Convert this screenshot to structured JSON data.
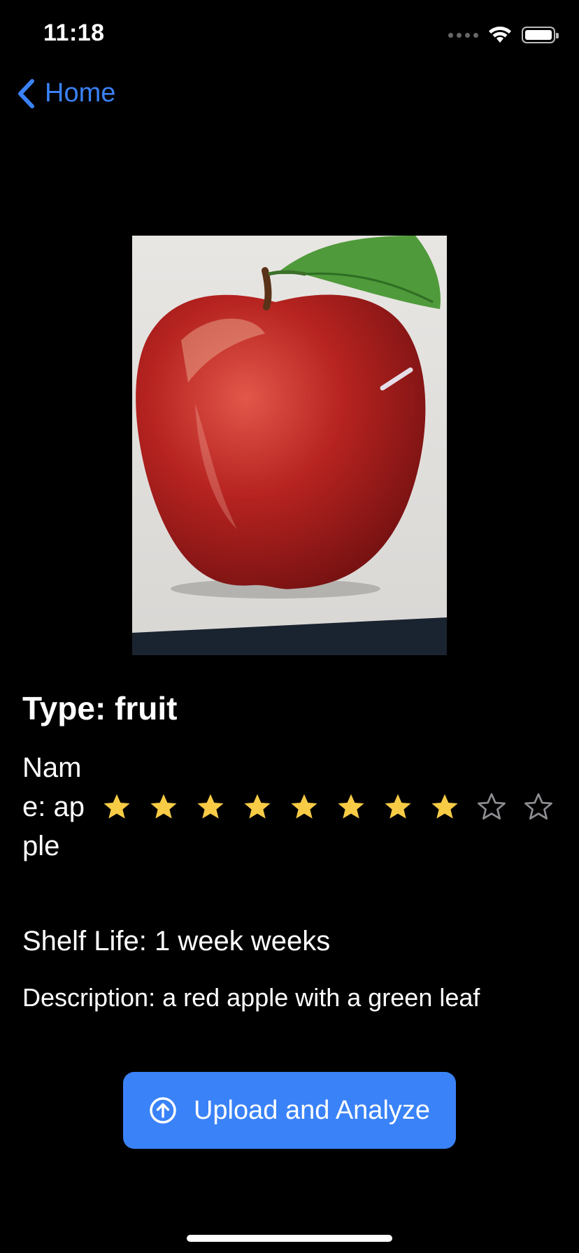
{
  "status_bar": {
    "time": "11:18"
  },
  "nav": {
    "back_label": "Home"
  },
  "result": {
    "type_text": "Type: fruit",
    "name_text": "Name: apple",
    "rating": 8,
    "rating_max": 10,
    "shelf_life_text": "Shelf Life: 1 week weeks",
    "description_text": "Description: a red apple with a green leaf"
  },
  "actions": {
    "upload_label": "Upload and Analyze"
  },
  "colors": {
    "accent": "#3a82f7",
    "star_filled": "#f7cb45",
    "star_empty": "#8e8e93",
    "background": "#000000"
  }
}
